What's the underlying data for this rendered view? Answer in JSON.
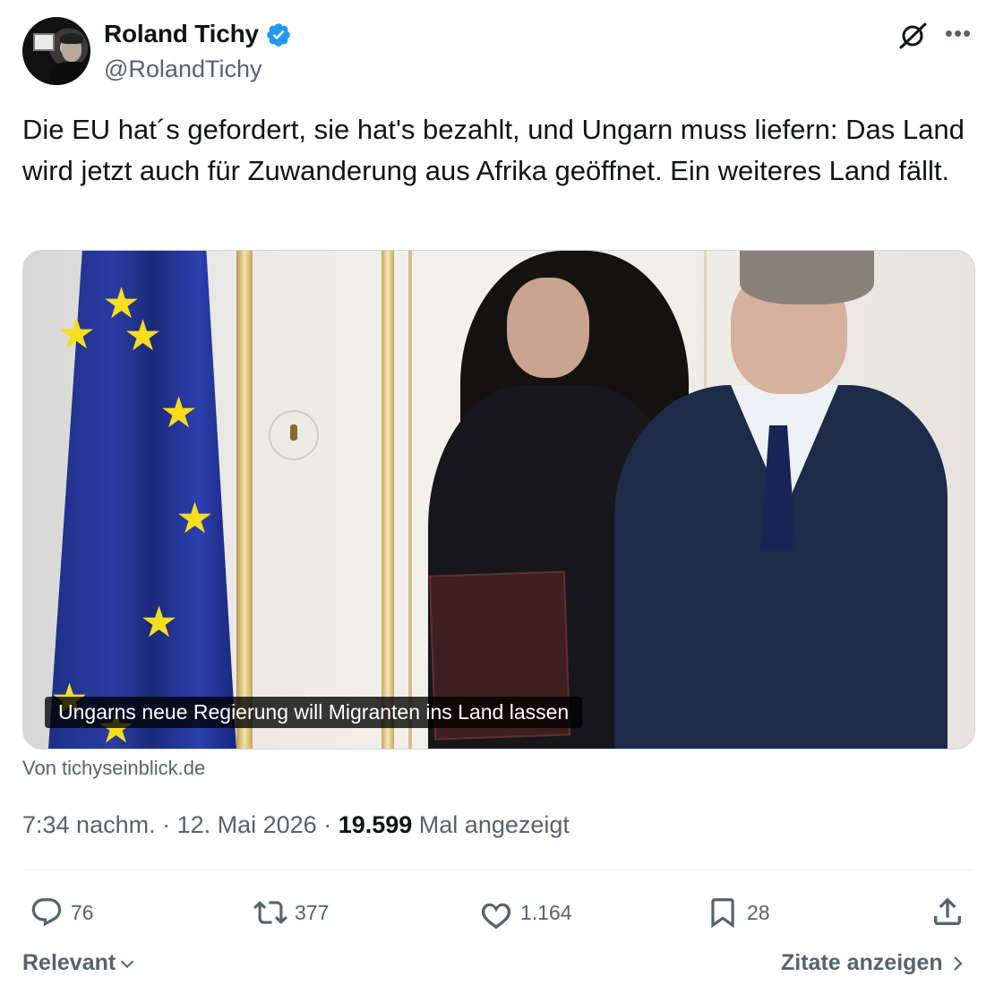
{
  "author": {
    "name": "Roland Tichy",
    "handle": "@RolandTichy",
    "verified": true,
    "verified_color": "#1d9bf0"
  },
  "tweet": {
    "text": "Die EU hat´s gefordert, sie hat's bezahlt, und Ungarn muss liefern: Das Land wird jetzt auch für Zuwanderung aus Afrika geöffnet. Ein weiteres Land fällt."
  },
  "card": {
    "caption": "Ungarns neue Regierung will Migranten ins Land lassen",
    "source": "Von tichyseinblick.de"
  },
  "meta": {
    "time": "7:34 nachm.",
    "sep1": " · ",
    "date": "12. Mai 2026",
    "sep2": " · ",
    "views": "19.599",
    "views_label": " Mal angezeigt"
  },
  "actions": {
    "replies": "76",
    "reposts": "377",
    "likes": "1.164",
    "bookmarks": "28"
  },
  "footer": {
    "sort": "Relevant",
    "quotes": "Zitate anzeigen"
  },
  "icons": [
    "grok-icon",
    "more-icon",
    "verified-badge-icon",
    "reply-icon",
    "repost-icon",
    "like-icon",
    "bookmark-icon",
    "share-icon",
    "chevron-down-icon",
    "chevron-right-icon"
  ]
}
